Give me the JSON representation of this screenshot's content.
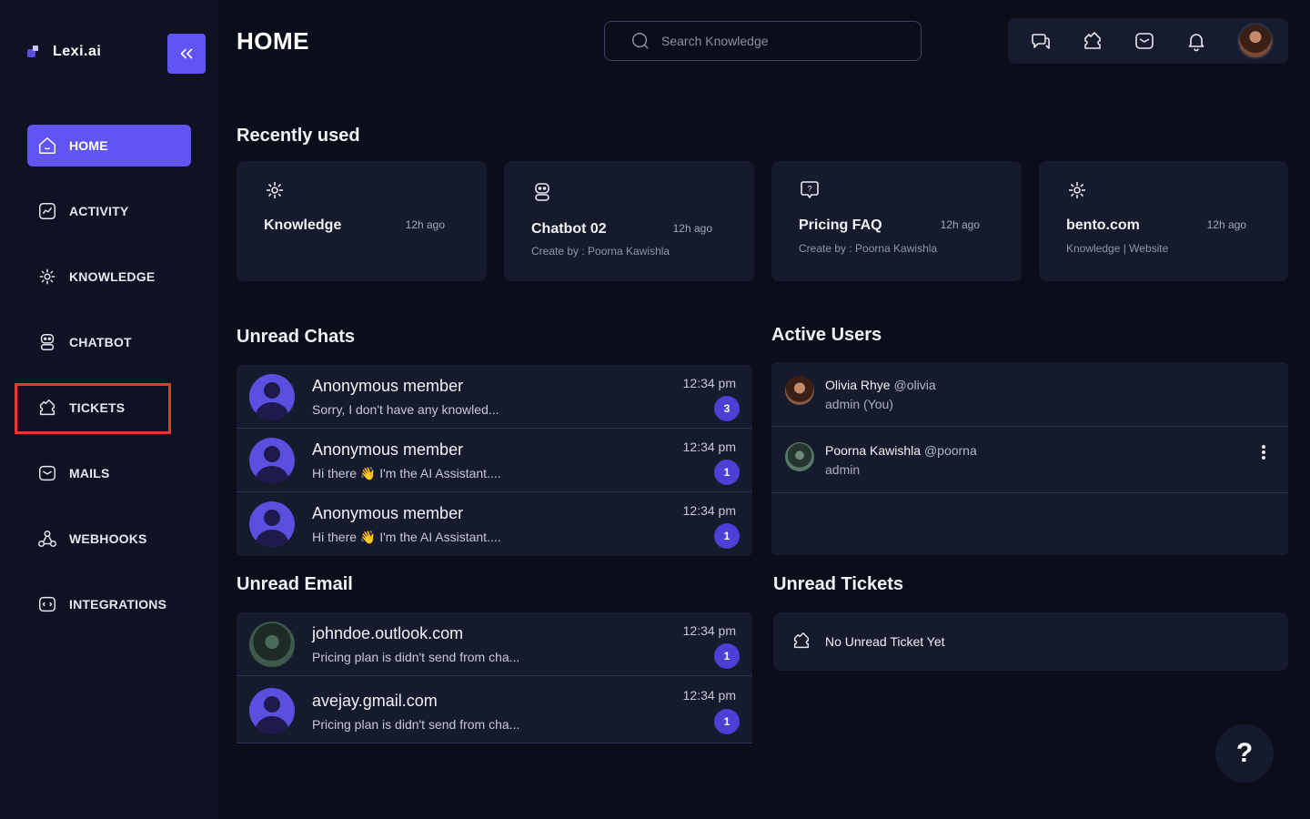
{
  "app": {
    "name": "Lexi.ai"
  },
  "sidebar": {
    "items": [
      {
        "label": "HOME",
        "icon": "home-icon",
        "active": true
      },
      {
        "label": "ACTIVITY",
        "icon": "activity-icon"
      },
      {
        "label": "KNOWLEDGE",
        "icon": "knowledge-icon"
      },
      {
        "label": "CHATBOT",
        "icon": "chatbot-icon"
      },
      {
        "label": "TICKETS",
        "icon": "ticket-icon"
      },
      {
        "label": "MAILS",
        "icon": "mail-icon"
      },
      {
        "label": "WEBHOOKS",
        "icon": "webhook-icon"
      },
      {
        "label": "INTEGRATIONS",
        "icon": "integrations-icon"
      }
    ]
  },
  "header": {
    "title": "HOME",
    "search_placeholder": "Search Knowledge"
  },
  "recently_used": {
    "title": "Recently used",
    "cards": [
      {
        "title": "Knowledge",
        "time": "12h ago",
        "subtitle": ""
      },
      {
        "title": "Chatbot 02",
        "time": "12h ago",
        "subtitle": "Create by : Poorna Kawishla"
      },
      {
        "title": "Pricing FAQ",
        "time": "12h ago",
        "subtitle": "Create by : Poorna Kawishla"
      },
      {
        "title": "bento.com",
        "time": "12h ago",
        "subtitle": "Knowledge | Website"
      }
    ]
  },
  "unread_chats": {
    "title": "Unread Chats",
    "rows": [
      {
        "name": "Anonymous member",
        "message": "Sorry, I don't have any knowled...",
        "time": "12:34 pm",
        "count": "3"
      },
      {
        "name": "Anonymous member",
        "message": "Hi there 👋 I'm the AI Assistant....",
        "time": "12:34 pm",
        "count": "1"
      },
      {
        "name": "Anonymous member",
        "message": "Hi there 👋 I'm the AI Assistant....",
        "time": "12:34 pm",
        "count": "1"
      }
    ]
  },
  "unread_email": {
    "title": "Unread Email",
    "rows": [
      {
        "name": "johndoe.outlook.com",
        "message": "Pricing plan is didn't send from cha...",
        "time": "12:34 pm",
        "count": "1"
      },
      {
        "name": "avejay.gmail.com",
        "message": "Pricing plan is didn't send from cha...",
        "time": "12:34 pm",
        "count": "1"
      }
    ]
  },
  "active_users": {
    "title": "Active Users",
    "users": [
      {
        "name": "Olivia Rhye",
        "handle": "@olivia",
        "role": "admin (You)"
      },
      {
        "name": "Poorna Kawishla",
        "handle": "@poorna",
        "role": "admin"
      }
    ]
  },
  "unread_tickets": {
    "title": "Unread Tickets",
    "empty_text": "No Unread Ticket Yet"
  },
  "help": {
    "label": "?"
  },
  "colors": {
    "accent": "#6055f2",
    "background": "#0b0e1a",
    "card": "#151a2c",
    "highlight": "#e23b2e"
  }
}
